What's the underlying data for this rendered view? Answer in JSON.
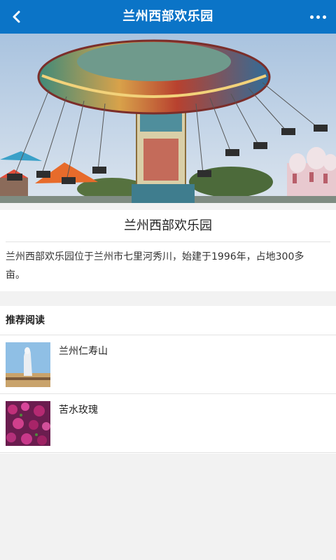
{
  "header": {
    "title": "兰州西部欢乐园",
    "back_icon": "chevron-left-icon",
    "more_icon": "more-dots-icon",
    "bg_color": "#0b74c7"
  },
  "hero": {
    "image": "swing-ride-photo"
  },
  "article": {
    "title": "兰州西部欢乐园",
    "description": "兰州西部欢乐园位于兰州市七里河秀川，始建于1996年，占地300多亩。"
  },
  "recommend": {
    "section_title": "推荐阅读",
    "items": [
      {
        "label": "兰州仁寿山",
        "thumb": "statue-photo"
      },
      {
        "label": "苦水玫瑰",
        "thumb": "roses-photo"
      }
    ]
  }
}
